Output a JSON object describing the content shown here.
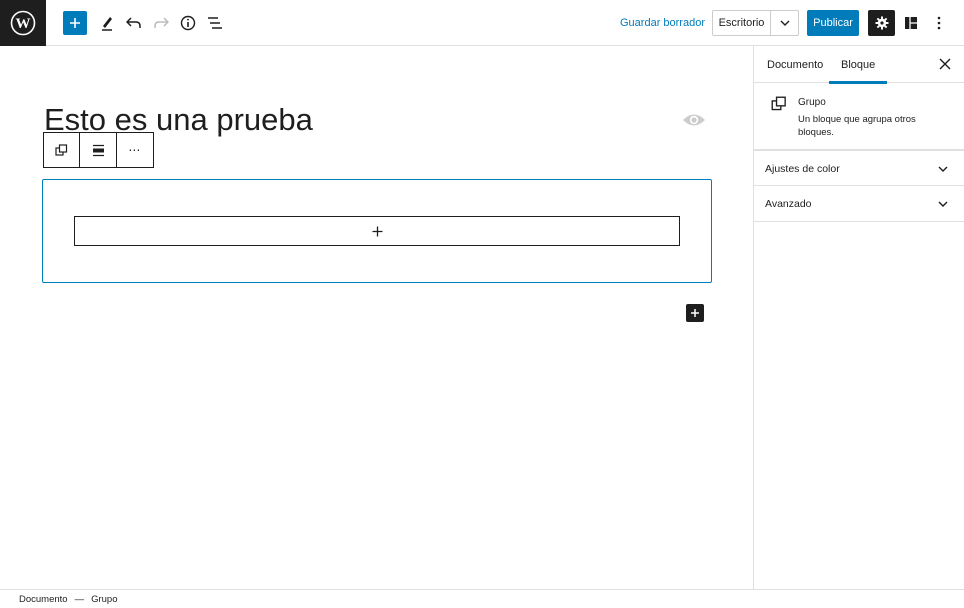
{
  "topbar": {
    "save_draft": "Guardar borrador",
    "preview_label": "Escritorio",
    "publish": "Publicar",
    "icons": [
      "wordpress-logo",
      "plus-icon",
      "pencil-icon",
      "undo-icon",
      "redo-icon",
      "info-icon",
      "list-view-icon",
      "chevron-down-icon",
      "gear-icon",
      "layout-icon",
      "more-vertical-icon"
    ]
  },
  "editor": {
    "post_title": "Esto es una prueba",
    "block_toolbar": {
      "icons": [
        "group-block-icon",
        "align-icon",
        "more-horizontal-icon"
      ],
      "more_label": "⋯"
    }
  },
  "sidebar": {
    "tabs": [
      "Documento",
      "Bloque"
    ],
    "active_tab": "Bloque",
    "block_card": {
      "name": "Grupo",
      "description": "Un bloque que agrupa otros bloques."
    },
    "panels": [
      "Ajustes de color",
      "Avanzado"
    ]
  },
  "footer": {
    "breadcrumb": [
      "Documento",
      "—",
      "Grupo"
    ]
  },
  "colors": {
    "accent": "#007cba",
    "dark": "#1e1e1e",
    "border": "#e0e0e0"
  }
}
